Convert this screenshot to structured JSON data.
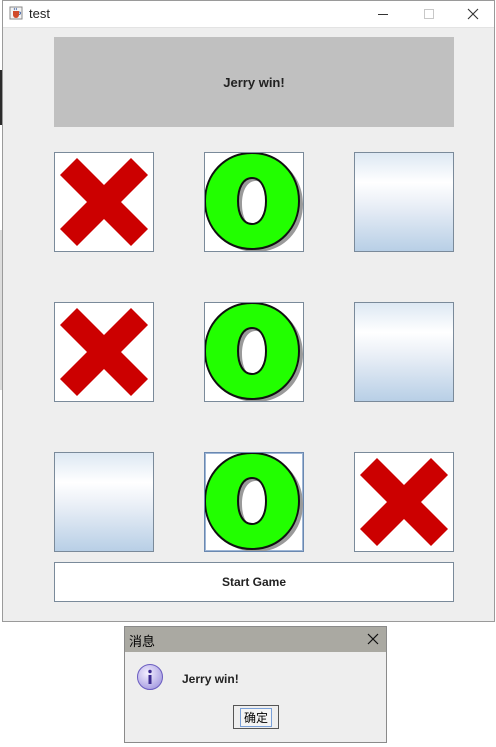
{
  "window": {
    "title": "test"
  },
  "game": {
    "status": "Jerry win!",
    "board": [
      "X",
      "O",
      "",
      "X",
      "O",
      "",
      "",
      "O",
      "X"
    ],
    "start_label": "Start Game"
  },
  "dialog": {
    "title": "消息",
    "message": "Jerry win!",
    "ok_label": "确定"
  },
  "colors": {
    "x_mark": "#cc0000",
    "o_mark": "#22ff00",
    "status_bg": "#c0c0c0",
    "dialog_titlebar": "#aaa9a2"
  },
  "icons": {
    "app": "java-coffee-icon",
    "dialog": "information-icon"
  }
}
